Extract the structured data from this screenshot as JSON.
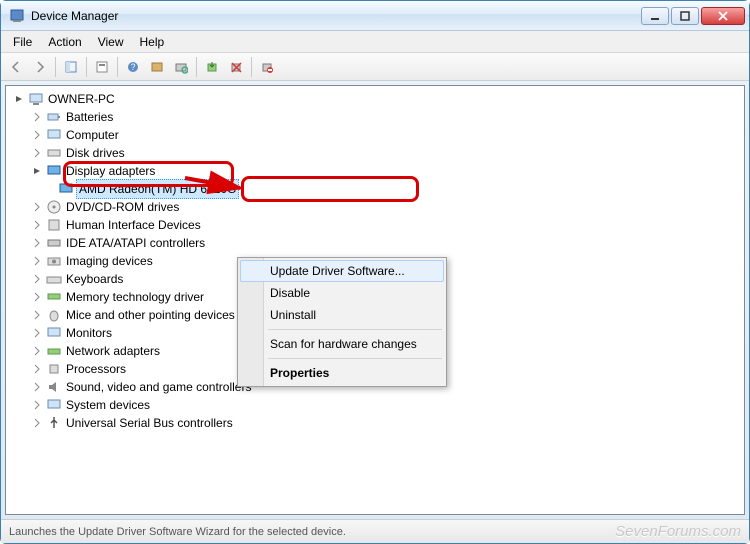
{
  "window": {
    "title": "Device Manager"
  },
  "menubar": [
    "File",
    "Action",
    "View",
    "Help"
  ],
  "tree": {
    "root": "OWNER-PC",
    "selected": "AMD Radeon(TM) HD 6520G",
    "categories": [
      "Batteries",
      "Computer",
      "Disk drives",
      "Display adapters",
      "DVD/CD-ROM drives",
      "Human Interface Devices",
      "IDE ATA/ATAPI controllers",
      "Imaging devices",
      "Keyboards",
      "Memory technology driver",
      "Mice and other pointing devices",
      "Monitors",
      "Network adapters",
      "Processors",
      "Sound, video and game controllers",
      "System devices",
      "Universal Serial Bus controllers"
    ]
  },
  "context_menu": {
    "update": "Update Driver Software...",
    "disable": "Disable",
    "uninstall": "Uninstall",
    "scan": "Scan for hardware changes",
    "properties": "Properties"
  },
  "status": "Launches the Update Driver Software Wizard for the selected device.",
  "watermark": "SevenForums.com"
}
